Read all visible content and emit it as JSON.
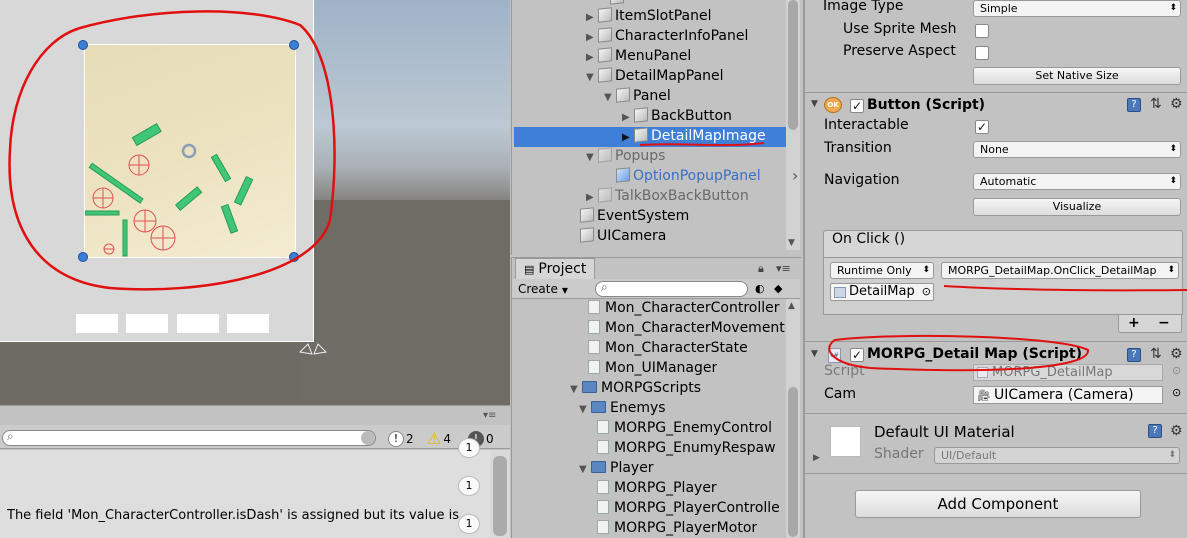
{
  "console": {
    "counts": {
      "info": "2",
      "warn": "4",
      "error": "0"
    },
    "message": "The field 'Mon_CharacterController.isDash' is assigned but its value is",
    "badges": [
      "1",
      "1",
      "1"
    ]
  },
  "hierarchy": {
    "items": [
      {
        "label": "ItemSlotPanel",
        "indent": 1,
        "arrow": "▶"
      },
      {
        "label": "CharacterInfoPanel",
        "indent": 1,
        "arrow": "▶"
      },
      {
        "label": "MenuPanel",
        "indent": 1,
        "arrow": "▶"
      },
      {
        "label": "DetailMapPanel",
        "indent": 1,
        "arrow": "▼"
      },
      {
        "label": "Panel",
        "indent": 2,
        "arrow": "▼"
      },
      {
        "label": "BackButton",
        "indent": 3,
        "arrow": "▶"
      },
      {
        "label": "DetailMapImage",
        "indent": 3,
        "arrow": "▶",
        "selected": true
      },
      {
        "label": "Popups",
        "indent": 1,
        "arrow": "▼",
        "dim": true
      },
      {
        "label": "OptionPopupPanel",
        "indent": 2,
        "arrow": "",
        "prefab": true
      },
      {
        "label": "TalkBoxBackButton",
        "indent": 1,
        "arrow": "▶",
        "dim": true
      },
      {
        "label": "EventSystem",
        "indent": 0,
        "arrow": ""
      },
      {
        "label": "UICamera",
        "indent": 0,
        "arrow": ""
      }
    ]
  },
  "project": {
    "tab": "Project",
    "create": "Create",
    "items": [
      {
        "label": "Mon_CharacterController",
        "type": "script",
        "indent": 4
      },
      {
        "label": "Mon_CharacterMovement",
        "type": "script",
        "indent": 4
      },
      {
        "label": "Mon_CharacterState",
        "type": "script",
        "indent": 4
      },
      {
        "label": "Mon_UIManager",
        "type": "script",
        "indent": 4
      },
      {
        "label": "MORPGScripts",
        "type": "folder",
        "indent": 2,
        "arrow": "▼"
      },
      {
        "label": "Enemys",
        "type": "folder",
        "indent": 3,
        "arrow": "▼"
      },
      {
        "label": "MORPG_EnemyControl",
        "type": "script",
        "indent": 5
      },
      {
        "label": "MORPG_EnumyRespaw",
        "type": "script",
        "indent": 5
      },
      {
        "label": "Player",
        "type": "folder",
        "indent": 3,
        "arrow": "▼"
      },
      {
        "label": "MORPG_Player",
        "type": "script",
        "indent": 5
      },
      {
        "label": "MORPG_PlayerControlle",
        "type": "script",
        "indent": 5
      },
      {
        "label": "MORPG_PlayerMotor",
        "type": "script",
        "indent": 5
      }
    ]
  },
  "inspector": {
    "image_type_label": "Image Type",
    "image_type_value": "Simple",
    "use_sprite_mesh": "Use Sprite Mesh",
    "preserve_aspect": "Preserve Aspect",
    "set_native_size": "Set Native Size",
    "button_title": "Button (Script)",
    "interactable_label": "Interactable",
    "transition_label": "Transition",
    "transition_value": "None",
    "navigation_label": "Navigation",
    "navigation_value": "Automatic",
    "visualize": "Visualize",
    "onclick": "On Click ()",
    "runtime": "Runtime Only",
    "func": "MORPG_DetailMap.OnClick_DetailMap",
    "target_obj": "DetailMap",
    "plus": "+",
    "minus": "−",
    "script_title": "MORPG_Detail Map (Script)",
    "script_label": "Script",
    "script_value": "MORPG_DetailMap",
    "cam_label": "Cam",
    "cam_value": "UICamera (Camera)",
    "material_name": "Default UI Material",
    "shader_label": "Shader",
    "shader_value": "UI/Default",
    "add_component": "Add Component"
  }
}
